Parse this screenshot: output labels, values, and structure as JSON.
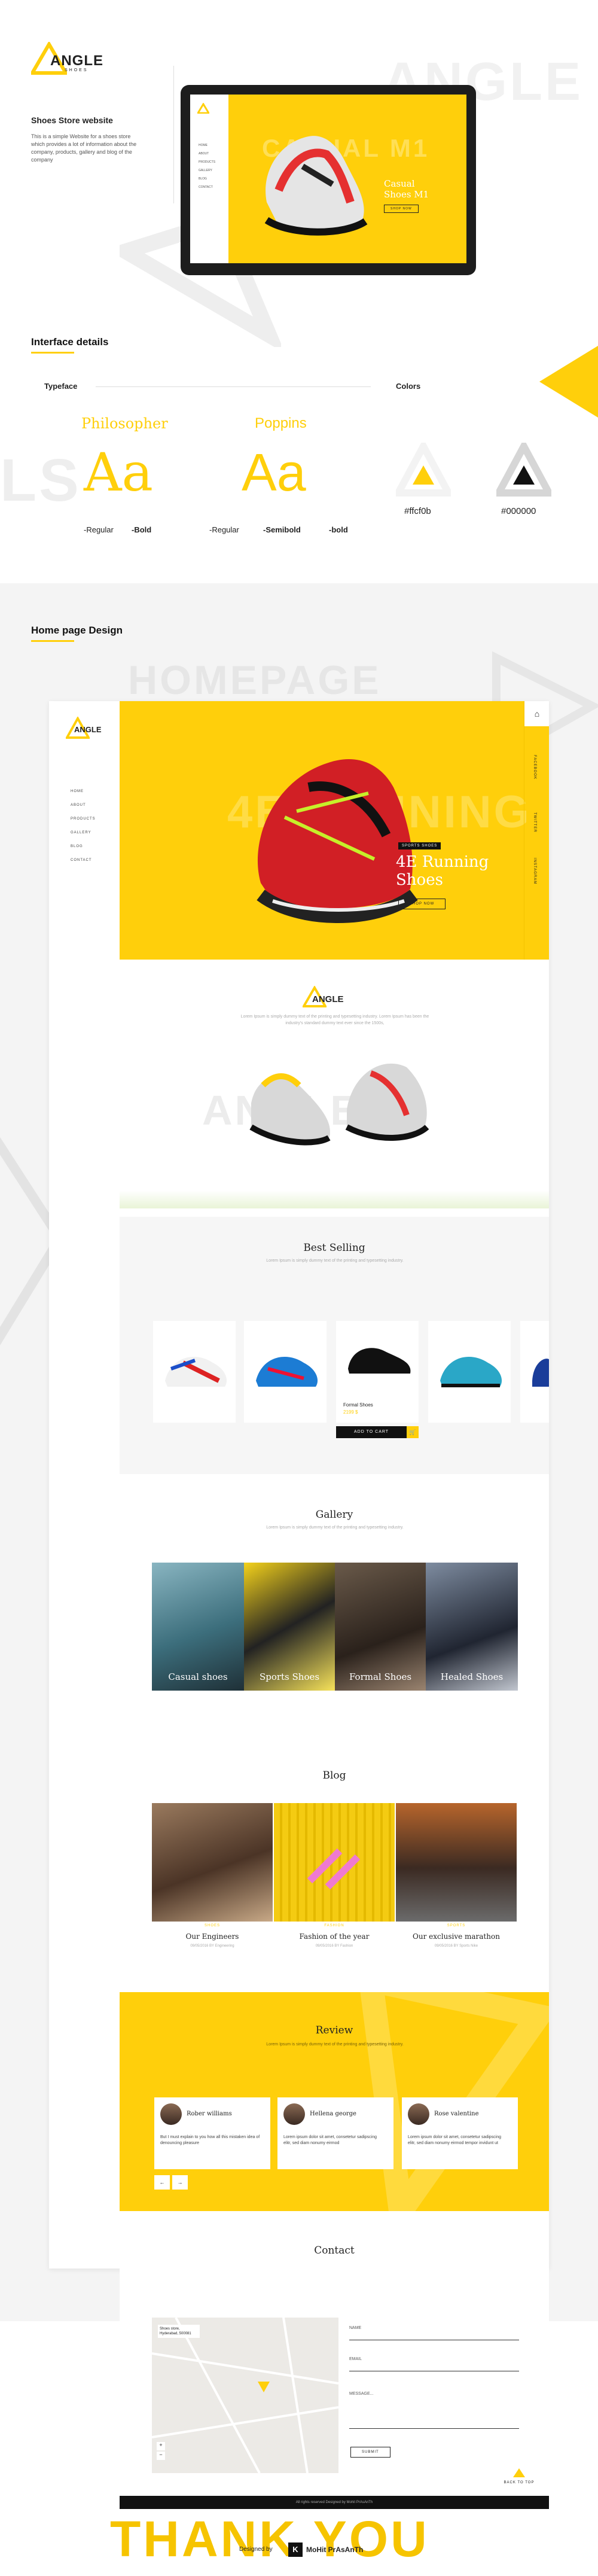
{
  "brand": {
    "name": "ANGLE",
    "tagline": "SHOES"
  },
  "intro": {
    "title": "Shoes Store website",
    "description": "This is a simple Website for a shoes store which provides a lot of information about the company, products, gallery and blog of the company"
  },
  "mockup": {
    "ghost_text": "CASUAL M1",
    "nav": [
      "HOME",
      "ABOUT",
      "PRODUCTS",
      "GALLERY",
      "BLOG",
      "CONTACT"
    ],
    "headline": "Casual Shoes M1",
    "button": "SHOP NOW"
  },
  "interface": {
    "title": "Interface details",
    "typeface_label": "Typeface",
    "colors_label": "Colors",
    "font1": {
      "name": "Philosopher",
      "sample": "Aa",
      "weights": [
        "-Regular",
        "-Bold"
      ]
    },
    "font2": {
      "name": "Poppins",
      "sample": "Aa",
      "weights": [
        "-Regular",
        "-Semibold",
        "-bold"
      ]
    },
    "color1": "#ffcf0b",
    "color2": "#000000",
    "ghost_left": "LS"
  },
  "homepage": {
    "title": "Home page Design",
    "ghost": "HOMEPAGE"
  },
  "hero": {
    "nav": [
      "HOME",
      "ABOUT",
      "PRODUCTS",
      "GALLERY",
      "BLOG",
      "CONTACT"
    ],
    "ghost": "4E RUNNING",
    "badge": "SPORTS SHOES",
    "headline_line1": "4E Running",
    "headline_line2": "Shoes",
    "button": "SHOP NOW",
    "side_tabs": [
      "FACEBOOK",
      "TWITTER",
      "INSTAGRAM"
    ]
  },
  "about": {
    "text": "Lorem Ipsum is simply dummy text of the printing and typesetting industry. Lorem Ipsum has been the industry's standard dummy text ever since the 1500s,",
    "ghost": "ANGLE"
  },
  "best_selling": {
    "title": "Best Selling",
    "subtitle": "Lorem Ipsum is simply dummy text of the printing and typesetting industry.",
    "featured_name": "Formal Shoes",
    "featured_price": "2199 $",
    "add_to_cart": "ADD TO CART"
  },
  "gallery": {
    "title": "Gallery",
    "subtitle": "Lorem Ipsum is simply dummy text of the printing and typesetting industry.",
    "items": [
      "Casual shoes",
      "Sports Shoes",
      "Formal Shoes",
      "Healed Shoes"
    ]
  },
  "blog": {
    "title": "Blog",
    "posts": [
      {
        "tag": "SHOES",
        "title": "Our Engineers",
        "meta": "09/05/2016  BY Engineering"
      },
      {
        "tag": "FASHION",
        "title": "Fashion of the year",
        "meta": "09/05/2016  BY Fashion"
      },
      {
        "tag": "SPORTS",
        "title": "Our exclusive marathon",
        "meta": "09/05/2016  BY Sports Nike"
      }
    ]
  },
  "review": {
    "title": "Review",
    "subtitle": "Lorem Ipsum is simply dummy text of the printing and typesetting industry.",
    "items": [
      {
        "name": "Rober williams",
        "text": "But I must explain to you how all this mistaken idea of denouncing pleasure"
      },
      {
        "name": "Hellena george",
        "text": "Lorem ipsum dolor sit amet, consetetur sadipscing elitr, sed diam nonumy eirmod"
      },
      {
        "name": "Rose valentine",
        "text": "Lorem ipsum dolor sit amet, consetetur sadipscing elitr, sed diam nonumy eirmod tempor invidunt ut"
      }
    ]
  },
  "contact": {
    "title": "Contact",
    "name_label": "NAME",
    "email_label": "EMAIL",
    "message_label": "MESSAGE...",
    "submit": "SUBMIT",
    "back_to_top": "BACK TO TOP",
    "footer": "All rights reserved  Designed by  Mohit PrAsAnTh",
    "map_label": "Shoes store, Hyderabad, 500081"
  },
  "credits": {
    "thank_you": "THANK YOU",
    "designed_by": "Designed by",
    "designer": "MoHit PrAsAnTh"
  }
}
